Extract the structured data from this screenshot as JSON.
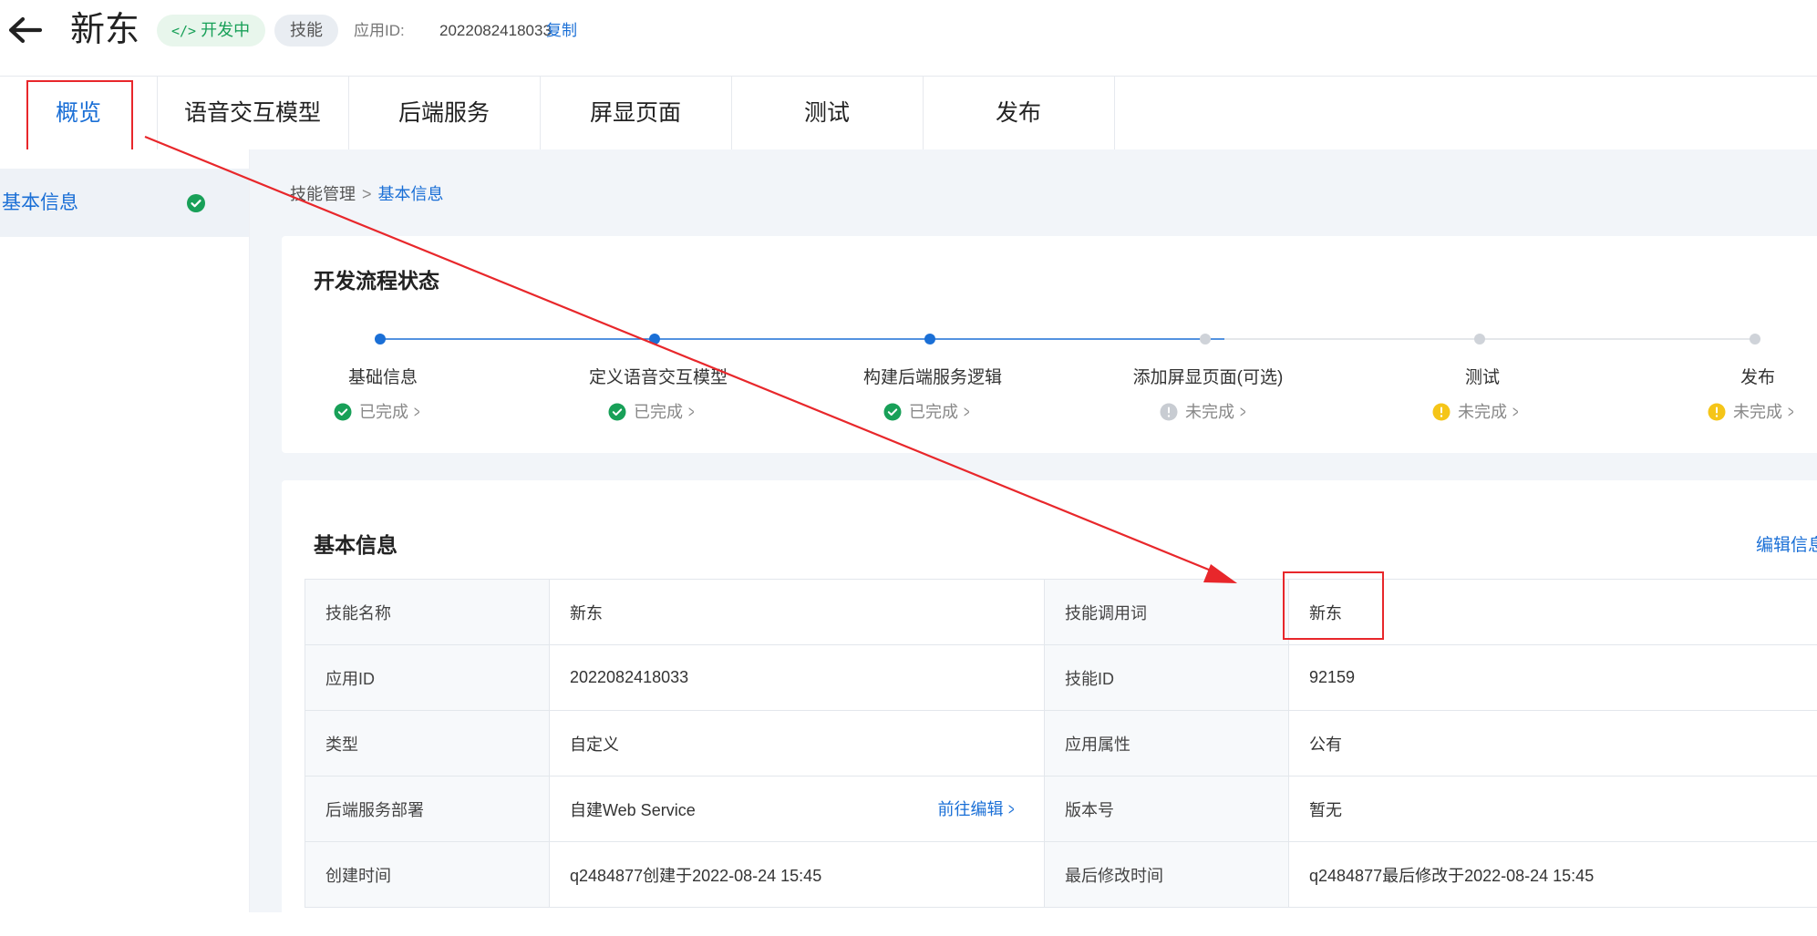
{
  "header": {
    "app_name": "新东",
    "status_badge": "开发中",
    "type_badge": "技能",
    "app_id_label": "应用ID:",
    "app_id_value": "2022082418033",
    "copy_label": "复制"
  },
  "tabs": [
    {
      "label": "概览"
    },
    {
      "label": "语音交互模型"
    },
    {
      "label": "后端服务"
    },
    {
      "label": "屏显页面"
    },
    {
      "label": "测试"
    },
    {
      "label": "发布"
    }
  ],
  "sidebar": {
    "items": [
      {
        "label": "基本信息"
      }
    ]
  },
  "breadcrumb": {
    "parent": "技能管理",
    "current": "基本信息"
  },
  "flow": {
    "title": "开发流程状态",
    "steps": [
      {
        "name": "基础信息",
        "status": "已完成",
        "state": "done"
      },
      {
        "name": "定义语音交互模型",
        "status": "已完成",
        "state": "done"
      },
      {
        "name": "构建后端服务逻辑",
        "status": "已完成",
        "state": "done"
      },
      {
        "name": "添加屏显页面(可选)",
        "status": "未完成",
        "state": "optional"
      },
      {
        "name": "测试",
        "status": "未完成",
        "state": "warning"
      },
      {
        "name": "发布",
        "status": "未完成",
        "state": "warning"
      }
    ]
  },
  "basic_info": {
    "title": "基本信息",
    "edit_label": "编辑信息",
    "rows": [
      {
        "k1": "技能名称",
        "v1": "新东",
        "k2": "技能调用词",
        "v2": "新东"
      },
      {
        "k1": "应用ID",
        "v1": "2022082418033",
        "k2": "技能ID",
        "v2": "92159"
      },
      {
        "k1": "类型",
        "v1": "自定义",
        "k2": "应用属性",
        "v2": "公有"
      },
      {
        "k1": "后端服务部署",
        "v1": "自建Web Service",
        "v1_link": "前往编辑",
        "k2": "版本号",
        "v2": "暂无"
      },
      {
        "k1": "创建时间",
        "v1": "q2484877创建于2022-08-24 15:45",
        "k2": "最后修改时间",
        "v2": "q2484877最后修改于2022-08-24 15:45"
      }
    ]
  },
  "colors": {
    "accent": "#1a6fd6",
    "success": "#18a058",
    "warning": "#f5c518",
    "annotation": "#e8272b"
  }
}
